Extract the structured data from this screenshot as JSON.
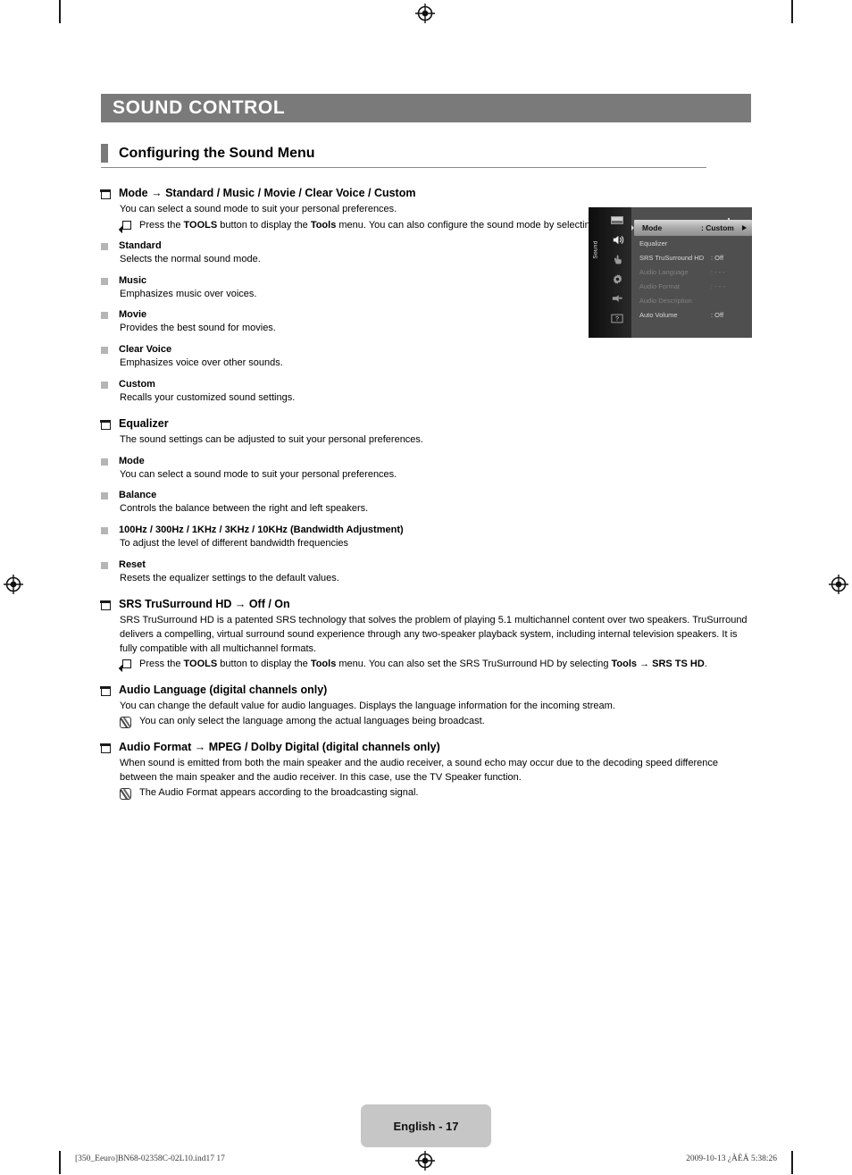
{
  "header": {
    "title": "SOUND CONTROL",
    "section_title": "Configuring the Sound Menu"
  },
  "sections": [
    {
      "heading": "Mode → Standard / Music / Movie / Clear Voice / Custom",
      "intro": "You can select a sound mode to suit your personal preferences.",
      "tools_note": "Press the TOOLS button to display the Tools menu. You can also configure the sound mode by selecting Tools → Sound Mode.",
      "items": [
        {
          "term": "Standard",
          "desc": "Selects the normal sound mode."
        },
        {
          "term": "Music",
          "desc": "Emphasizes music over voices."
        },
        {
          "term": "Movie",
          "desc": "Provides the best sound for movies."
        },
        {
          "term": "Clear Voice",
          "desc": "Emphasizes voice over other sounds."
        },
        {
          "term": "Custom",
          "desc": "Recalls your customized sound settings."
        }
      ]
    },
    {
      "heading": "Equalizer",
      "intro": "The sound settings can be adjusted to suit your personal preferences.",
      "items": [
        {
          "term": "Mode",
          "desc": "You can select a sound mode to suit your personal preferences."
        },
        {
          "term": "Balance",
          "desc": "Controls the balance between the right and left speakers."
        },
        {
          "term": "100Hz / 300Hz / 1KHz / 3KHz / 10KHz (Bandwidth Adjustment)",
          "desc": "To adjust the level of different bandwidth frequencies"
        },
        {
          "term": "Reset",
          "desc": "Resets the equalizer settings to the default values."
        }
      ]
    },
    {
      "heading": "SRS TruSurround HD → Off / On",
      "intro": "SRS TruSurround HD is a patented SRS technology that solves the problem of playing 5.1 multichannel content over two speakers. TruSurround delivers a compelling, virtual surround sound experience through any two-speaker playback system, including internal television speakers. It is fully compatible with all multichannel formats.",
      "tools_note": "Press the TOOLS button to display the Tools menu. You can also set the SRS TruSurround HD by selecting Tools → SRS TS HD.",
      "items": []
    },
    {
      "heading": "Audio Language (digital channels only)",
      "intro": "You can change the default value for audio languages. Displays the language information for the incoming stream.",
      "pencil_note": "You can only select the language among the actual languages being broadcast.",
      "items": []
    },
    {
      "heading": "Audio Format → MPEG / Dolby Digital (digital channels only)",
      "intro": "When sound is emitted from both the main speaker and the audio receiver, a sound echo may occur due to the decoding speed difference between the main speaker and the audio receiver. In this case, use the TV Speaker function.",
      "pencil_note": "The Audio Format appears according to the broadcasting signal.",
      "items": []
    }
  ],
  "osd": {
    "rail_label": "Sound",
    "icons": [
      "picture-icon",
      "sound-icon",
      "channel-icon",
      "setup-icon",
      "input-icon",
      "support-icon"
    ],
    "rows": [
      {
        "label": "Mode",
        "value": ": Custom",
        "state": "highlighted",
        "arrow": true
      },
      {
        "label": "Equalizer",
        "value": "",
        "state": "normal",
        "arrow": false
      },
      {
        "label": "SRS TruSurround HD",
        "value": ": Off",
        "state": "normal",
        "arrow": false
      },
      {
        "label": "Audio Language",
        "value": ": - - -",
        "state": "dimmed",
        "arrow": false
      },
      {
        "label": "Audio Format",
        "value": ": - - -",
        "state": "dimmed",
        "arrow": false
      },
      {
        "label": "Audio Description",
        "value": "",
        "state": "dimmed",
        "arrow": false
      },
      {
        "label": "Auto Volume",
        "value": ": Off",
        "state": "normal",
        "arrow": false
      }
    ]
  },
  "footer": {
    "page_label": "English - 17",
    "file_info": "[350_Eeuro]BN68-02358C-02L10.ind17   17",
    "timestamp": "2009-10-13   ¿ÀÈÄ 5:38:26"
  },
  "colors": {
    "title_bar": "#7a7a7a",
    "page_tag": "#c6c6c6",
    "bullet_square": "#b5b5b5",
    "osd_background": "#4f4f4f"
  }
}
